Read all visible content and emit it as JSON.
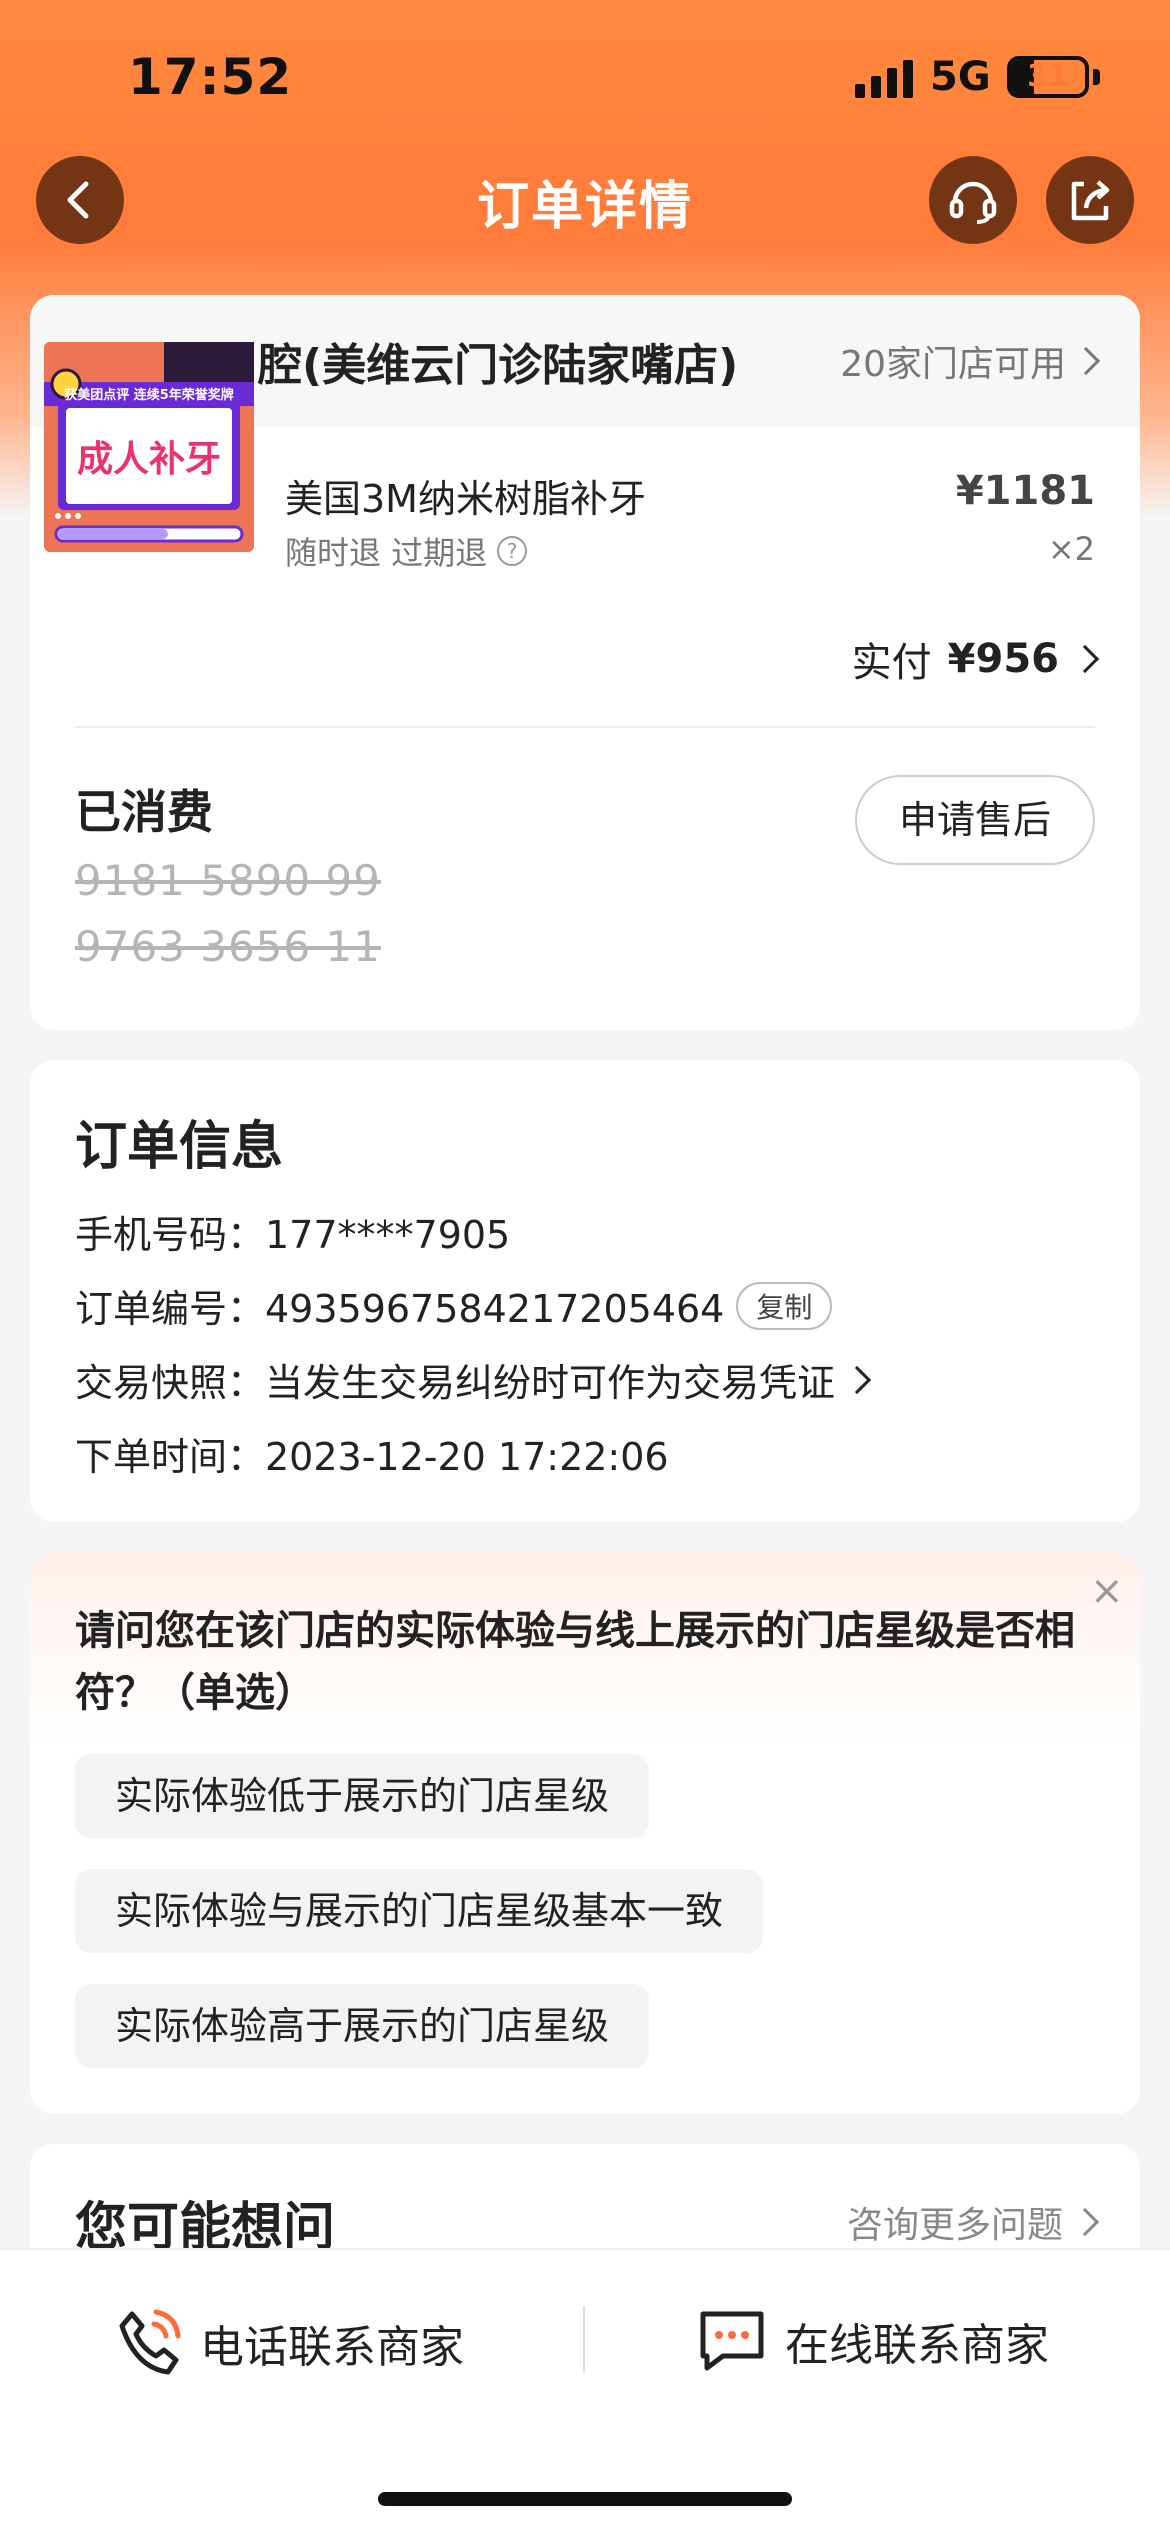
{
  "status_bar": {
    "time": "17:52",
    "network": "5G",
    "battery": "31"
  },
  "nav": {
    "title": "订单详情",
    "back_icon": "back-icon",
    "service_icon": "headset-icon",
    "share_icon": "share-icon"
  },
  "store": {
    "name": "维乐口腔(美维云门诊陆家嘴店)",
    "availability": "20家门店可用"
  },
  "product": {
    "thumb_badge": "获美团点评 连续5年荣誉奖牌",
    "thumb_text": "成人补牙",
    "name": "美国3M纳米树脂补牙",
    "price": "¥1181",
    "tags": "随时退 过期退",
    "quantity": "×2",
    "paid_label": "实付",
    "paid_amount": "¥956"
  },
  "consumed": {
    "title": "已消费",
    "codes": [
      "9181 5890 99",
      "9763 3656 11"
    ],
    "after_sales_label": "申请售后"
  },
  "order_info": {
    "title": "订单信息",
    "phone": "手机号码：177****7905",
    "order_no": "订单编号：4935967584217205464",
    "copy_label": "复制",
    "snapshot": "交易快照：当发生交易纠纷时可作为交易凭证",
    "order_time": "下单时间：2023-12-20 17:22:06"
  },
  "survey": {
    "question": "请问您在该门店的实际体验与线上展示的门店星级是否相符？（单选）",
    "options": [
      "实际体验低于展示的门店星级",
      "实际体验与展示的门店星级基本一致",
      "实际体验高于展示的门店星级"
    ],
    "close": "×"
  },
  "faq": {
    "title": "您可能想问",
    "more_label": "咨询更多问题"
  },
  "bottom": {
    "phone_label": "电话联系商家",
    "chat_label": "在线联系商家"
  },
  "colors": {
    "accent": "#ff7b3a",
    "thumb_pink": "#e8336b",
    "thumb_purple": "#6a2bd6"
  }
}
